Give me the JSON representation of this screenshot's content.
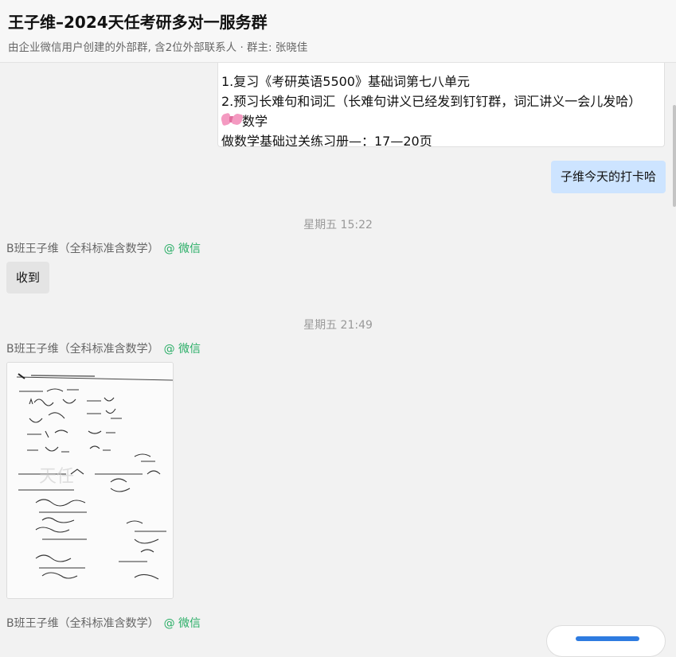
{
  "header": {
    "title": "王子维–2024天任考研多对一服务群",
    "subtitle": "由企业微信用户创建的外部群, 含2位外部联系人 · 群主: 张晓佳"
  },
  "messages": {
    "partial_lines": [
      "1.复习《考研英语5500》基础词第七八单元",
      "2.预习长难句和词汇（长难句讲义已经发到钉钉群，词汇讲义一会儿发哈）",
      "数学",
      "做数学基础过关练习册—：17—20页"
    ],
    "outgoing": "子维今天的打卡哈",
    "time1": "星期五 15:22",
    "sender1": "B班王子维（全科标准含数学）",
    "wechat1": "@ 微信",
    "incoming1": "收到",
    "time2": "星期五 21:49",
    "sender2": "B班王子维（全科标准含数学）",
    "wechat2": "@ 微信",
    "sender3": "B班王子维（全科标准含数学）",
    "wechat3": "@ 微信"
  },
  "colors": {
    "outgoing_bubble": "#cde4ff",
    "incoming_bubble": "#e4e4e4",
    "wechat_tag": "#2aae67"
  }
}
